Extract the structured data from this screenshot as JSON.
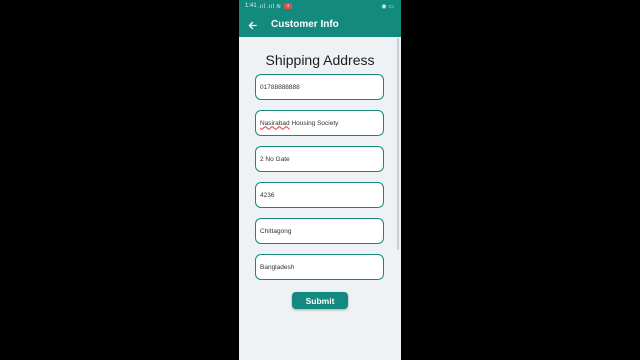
{
  "status_bar": {
    "time": "1:41",
    "signal": ".ııl .ııl ≋",
    "notification_badge": "4",
    "right_icons": "◉ ▭",
    "background": "#138a7e"
  },
  "app_bar": {
    "back_icon": "arrow-left-icon",
    "title": "Customer Info",
    "background": "#138a7e"
  },
  "form": {
    "heading": "Shipping Address",
    "fields": [
      {
        "value_misspelled": "",
        "value": "01788888888"
      },
      {
        "value_misspelled": "Nasirabad",
        "value": " Housing Society"
      },
      {
        "value_misspelled": "",
        "value": "2 No Gate"
      },
      {
        "value_misspelled": "",
        "value": "4236"
      },
      {
        "value_misspelled": "",
        "value": "Chittagong"
      },
      {
        "value_misspelled": "",
        "value": "Bangladesh"
      }
    ],
    "submit_label": "Submit",
    "accent": "#15887c"
  }
}
